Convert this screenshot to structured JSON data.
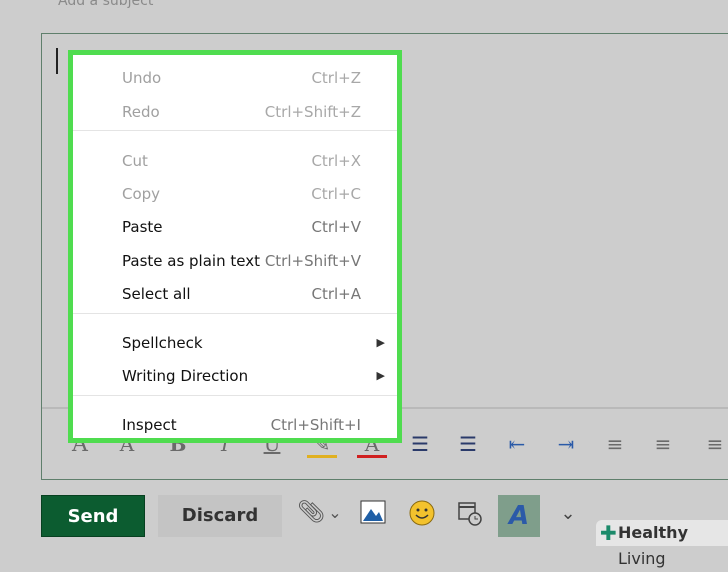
{
  "compose": {
    "subject_placeholder": "Add a subject"
  },
  "context_menu": {
    "items": [
      {
        "label": "Undo",
        "shortcut": "Ctrl+Z",
        "enabled": false
      },
      {
        "label": "Redo",
        "shortcut": "Ctrl+Shift+Z",
        "enabled": false
      },
      {
        "label": "Cut",
        "shortcut": "Ctrl+X",
        "enabled": false
      },
      {
        "label": "Copy",
        "shortcut": "Ctrl+C",
        "enabled": false
      },
      {
        "label": "Paste",
        "shortcut": "Ctrl+V",
        "enabled": true
      },
      {
        "label": "Paste as plain text",
        "shortcut": "Ctrl+Shift+V",
        "enabled": true
      },
      {
        "label": "Select all",
        "shortcut": "Ctrl+A",
        "enabled": true
      },
      {
        "label": "Spellcheck",
        "submenu": true,
        "enabled": true
      },
      {
        "label": "Writing Direction",
        "submenu": true,
        "enabled": true
      },
      {
        "label": "Inspect",
        "shortcut": "Ctrl+Shift+I",
        "enabled": true
      }
    ]
  },
  "format_toolbar": [
    "font-size-icon",
    "font-color-icon",
    "bold-icon",
    "italic-icon",
    "underline-icon",
    "highlight-icon",
    "text-color-icon",
    "bullets-icon",
    "numbering-icon",
    "outdent-icon",
    "indent-icon",
    "align-left-icon",
    "align-center-icon",
    "align-right-icon"
  ],
  "format_glyphs": {
    "font_size": "A",
    "font": "A",
    "bold": "B",
    "italic": "I",
    "underline": "U",
    "highlight": "✎",
    "color": "A",
    "bullets": "☰",
    "numbering": "☰",
    "outdent": "⇤",
    "indent": "⇥",
    "align_left": "≡",
    "align_center": "≡",
    "align_right": "≡"
  },
  "actions": {
    "send": "Send",
    "discard": "Discard",
    "format_glyph": "A"
  },
  "colors": {
    "send": "#0c5c30",
    "highlight_menu": "#4fdc4f",
    "highlight_underline": "#e0b020",
    "font_color_underline": "#d02020"
  },
  "watermark": {
    "text_bold": "Healthy",
    "text": "Living"
  }
}
